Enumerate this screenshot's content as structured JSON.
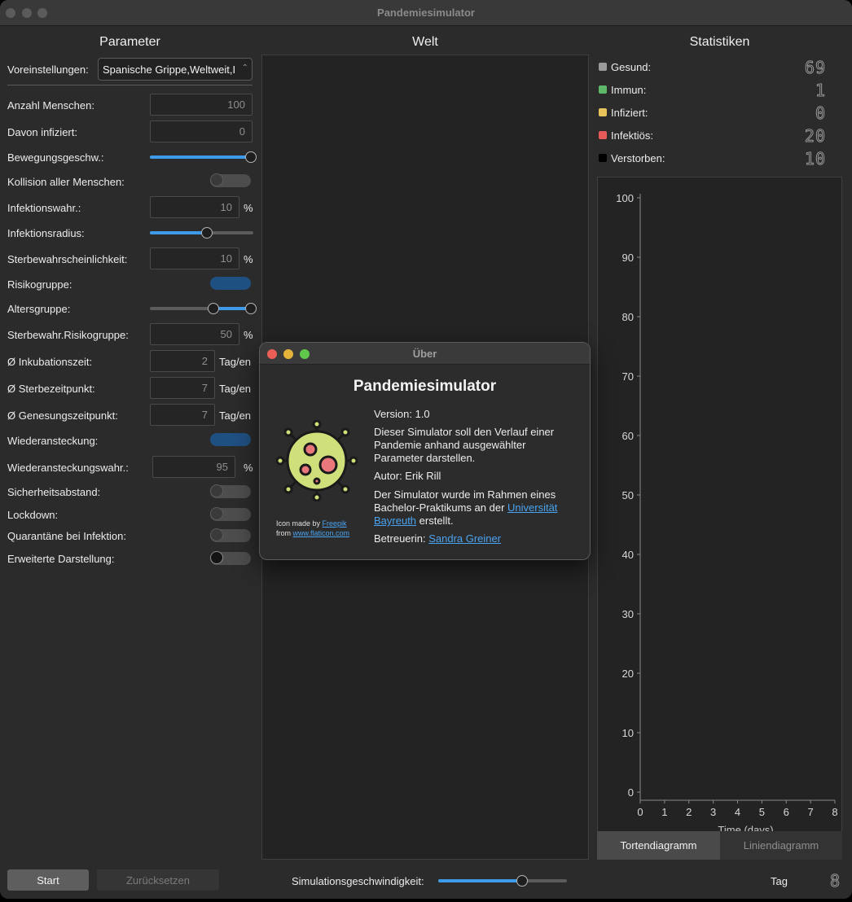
{
  "window": {
    "title": "Pandemiesimulator"
  },
  "sections": {
    "parameter": "Parameter",
    "world": "Welt",
    "stats": "Statistiken"
  },
  "params": {
    "preset_label": "Voreinstellungen:",
    "preset_value": "Spanische Grippe,Weltweit,I",
    "people_label": "Anzahl Menschen:",
    "people_value": "100",
    "infected_label": "Davon infiziert:",
    "infected_value": "0",
    "speed_label": "Bewegungsgeschw.:",
    "speed_level": 1.0,
    "collision_label": "Kollision aller Menschen:",
    "collision_on": false,
    "inf_prob_label": "Infektionswahr.:",
    "inf_prob_value": "10",
    "inf_prob_unit": "%",
    "inf_radius_label": "Infektionsradius:",
    "inf_radius_level": 0.55,
    "death_prob_label": "Sterbewahrscheinlichkeit:",
    "death_prob_value": "10",
    "death_prob_unit": "%",
    "risk_group_label": "Risikogruppe:",
    "risk_group_on": true,
    "age_group_label": "Altersgruppe:",
    "age_group_range": [
      0.63,
      1.0
    ],
    "risk_death_label": "Sterbewahr.Risikogruppe:",
    "risk_death_value": "50",
    "risk_death_unit": "%",
    "incubation_label": "Ø Inkubationszeit:",
    "incubation_value": "2",
    "incubation_unit": "Tag/en",
    "death_time_label": "Ø Sterbezeitpunkt:",
    "death_time_value": "7",
    "death_time_unit": "Tag/en",
    "recovery_label": "Ø Genesungszeitpunkt:",
    "recovery_value": "7",
    "recovery_unit": "Tag/en",
    "reinfection_label": "Wiederansteckung:",
    "reinfection_on": true,
    "reinfection_prob_label": "Wiederansteckungswahr.:",
    "reinfection_prob_value": "95",
    "reinfection_prob_unit": "%",
    "distance_label": "Sicherheitsabstand:",
    "distance_on": false,
    "lockdown_label": "Lockdown:",
    "lockdown_on": false,
    "quarantine_label": "Quarantäne bei Infektion:",
    "quarantine_on": false,
    "extended_label": "Erweiterte Darstellung:",
    "extended_on": false
  },
  "stats": {
    "healthy_label": "Gesund:",
    "healthy_value": "69",
    "healthy_color": "#9a9a9a",
    "immune_label": "Immun:",
    "immune_value": "1",
    "immune_color": "#5db86a",
    "infected_label": "Infiziert:",
    "infected_value": "0",
    "infected_color": "#e8c25a",
    "infectious_label": "Infektiös:",
    "infectious_value": "20",
    "infectious_color": "#e65a5a",
    "dead_label": "Verstorben:",
    "dead_value": "10",
    "dead_color": "#000000"
  },
  "chart_data": {
    "type": "line",
    "xlabel": "Time (days)",
    "ylabel": "",
    "xlim": [
      0,
      8
    ],
    "ylim": [
      0,
      100
    ],
    "x_ticks": [
      0,
      1,
      2,
      3,
      4,
      5,
      6,
      7,
      8
    ],
    "y_ticks": [
      0,
      10,
      20,
      30,
      40,
      50,
      60,
      70,
      80,
      90,
      100
    ],
    "series": []
  },
  "tabs": {
    "pie": "Tortendiagramm",
    "line": "Liniendiagramm"
  },
  "bottom": {
    "start": "Start",
    "reset": "Zurücksetzen",
    "sim_speed_label": "Simulationsgeschwindigkeit:",
    "sim_speed_level": 0.65,
    "day_label": "Tag",
    "day_value": "8"
  },
  "about": {
    "title": "Über",
    "heading": "Pandemiesimulator",
    "version": "Version: 1.0",
    "description": "Dieser Simulator soll den Verlauf einer Pandemie anhand ausgewählter Parameter darstellen.",
    "author": "Autor: Erik Rill",
    "context_pre": "Der Simulator wurde im Rahmen eines Bachelor-Praktikums an der ",
    "context_link": "Universität Bayreuth",
    "context_post": " erstellt.",
    "supervisor_pre": "Betreuerin: ",
    "supervisor_link": "Sandra Greiner",
    "credit_pre": "Icon made by ",
    "credit_author": "Freepik",
    "credit_from": "from ",
    "credit_site": "www.flaticon.com",
    "icon": "virus-icon"
  }
}
